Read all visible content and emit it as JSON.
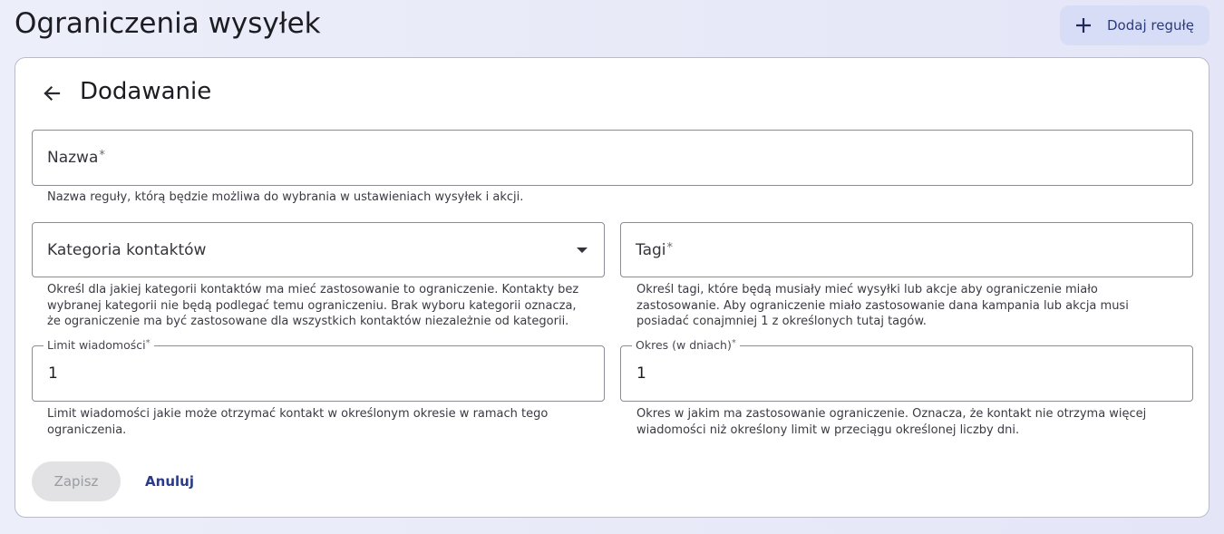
{
  "header": {
    "title": "Ograniczenia wysyłek",
    "add_button_label": "Dodaj regułę",
    "add_icon": "plus-icon"
  },
  "form": {
    "back_icon": "arrow-left-icon",
    "title": "Dodawanie",
    "name": {
      "label": "Nazwa",
      "required_mark": "*",
      "helper": "Nazwa reguły, którą będzie możliwa do wybrania w ustawieniach wysyłek i akcji."
    },
    "category": {
      "label": "Kategoria kontaktów",
      "dropdown_icon": "caret-down-icon",
      "helper": "Określ dla jakiej kategorii kontaktów ma mieć zastosowanie to ograniczenie. Kontakty bez\nwybranej kategorii nie będą podlegać temu ograniczeniu. Brak wyboru kategorii oznacza,\nże ograniczenie ma być zastosowane dla wszystkich kontaktów niezależnie od kategorii."
    },
    "tags": {
      "label": "Tagi",
      "required_mark": "*",
      "helper": "Określ tagi, które będą musiały mieć wysyłki lub akcje aby ograniczenie miało\nzastosowanie. Aby ograniczenie miało zastosowanie dana kampania lub akcja musi\nposiadać conajmniej 1 z określonych tutaj tagów."
    },
    "limit": {
      "label": "Limit wiadomości",
      "required_mark": "*",
      "value": "1",
      "helper": "Limit wiadomości jakie może otrzymać kontakt w określonym okresie w ramach tego\nograniczenia."
    },
    "period": {
      "label": "Okres (w dniach)",
      "required_mark": "*",
      "value": "1",
      "helper": "Okres w jakim ma zastosowanie ograniczenie. Oznacza, że kontakt nie otrzyma więcej\nwiadomości niż określony limit w przeciągu określonej liczby dni."
    },
    "save_label": "Zapisz",
    "cancel_label": "Anuluj"
  },
  "colors": {
    "accent": "#2b3b8a",
    "add_button_bg": "#d8ddf7",
    "disabled_button_bg": "#e2e2e5"
  }
}
